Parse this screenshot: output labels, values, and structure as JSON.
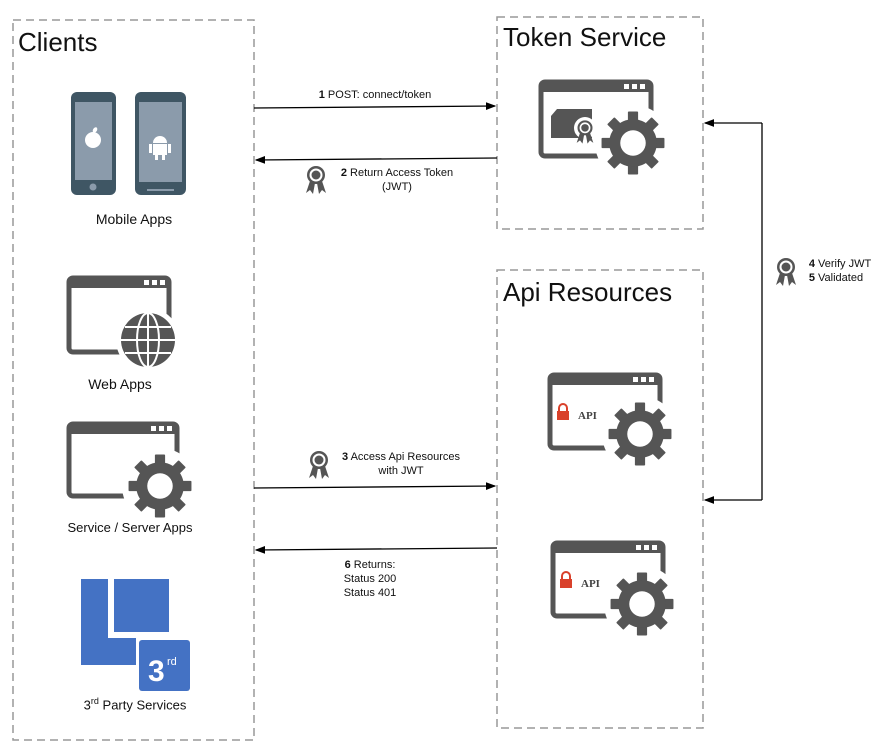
{
  "clients": {
    "title": "Clients",
    "mobile_apps": "Mobile Apps",
    "web_apps": "Web Apps",
    "service_apps": "Service / Server Apps",
    "third_party": {
      "sup": "rd",
      "prefix": "3",
      "rest": " Party Services",
      "badge_num": "3",
      "badge_sup": "rd"
    }
  },
  "token_service": {
    "title": "Token Service"
  },
  "api_resources": {
    "title": "Api Resources",
    "api_label": "API"
  },
  "flows": {
    "step1": {
      "num": "1",
      "text": "POST: connect/token"
    },
    "step2": {
      "num": "2",
      "text": "Return Access Token",
      "line2": "(JWT)"
    },
    "step3": {
      "num": "3",
      "text": "Access Api Resources",
      "line2": "with JWT"
    },
    "step4": {
      "num": "4",
      "text": "Verify JWT"
    },
    "step5": {
      "num": "5",
      "text": "Validated"
    },
    "step6": {
      "num": "6",
      "text": "Returns:",
      "line2": "Status 200",
      "line3": "Status 401"
    }
  },
  "colors": {
    "icon": "#555555",
    "phone": "#3f5664",
    "screen": "#8b9bab",
    "blue": "#4472c4",
    "lock": "#d9412b"
  }
}
